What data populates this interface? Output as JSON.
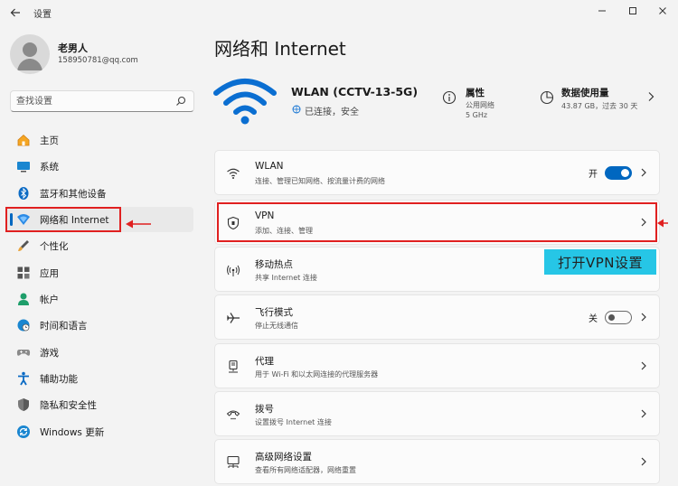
{
  "window": {
    "title": "设置"
  },
  "user": {
    "name": "老男人",
    "email": "158950781@qq.com"
  },
  "search": {
    "placeholder": "查找设置"
  },
  "sidebar": {
    "items": [
      {
        "label": "主页",
        "icon": "home-icon"
      },
      {
        "label": "系统",
        "icon": "monitor-icon"
      },
      {
        "label": "蓝牙和其他设备",
        "icon": "bluetooth-icon"
      },
      {
        "label": "网络和 Internet",
        "icon": "network-icon",
        "selected": true
      },
      {
        "label": "个性化",
        "icon": "brush-icon"
      },
      {
        "label": "应用",
        "icon": "apps-icon"
      },
      {
        "label": "帐户",
        "icon": "account-icon"
      },
      {
        "label": "时间和语言",
        "icon": "globe-clock-icon"
      },
      {
        "label": "游戏",
        "icon": "gamepad-icon"
      },
      {
        "label": "辅助功能",
        "icon": "accessibility-icon"
      },
      {
        "label": "隐私和安全性",
        "icon": "shield-icon"
      },
      {
        "label": "Windows 更新",
        "icon": "update-icon"
      }
    ]
  },
  "main": {
    "title": "网络和 Internet",
    "network": {
      "name": "WLAN (CCTV-13-5G)",
      "status": "已连接，安全"
    },
    "properties": {
      "title": "属性",
      "lines": [
        "公用网络",
        "5 GHz"
      ]
    },
    "usage": {
      "title": "数据使用量",
      "detail": "43.87 GB，过去 30 天"
    },
    "cards": [
      {
        "title": "WLAN",
        "desc": "连接、管理已知网络、按流量计费的网络",
        "icon": "wifi-icon",
        "toggle_label": "开",
        "toggle": "on"
      },
      {
        "title": "VPN",
        "desc": "添加、连接、管理",
        "icon": "vpn-shield-icon"
      },
      {
        "title": "移动热点",
        "desc": "共享 Internet 连接",
        "icon": "hotspot-icon"
      },
      {
        "title": "飞行模式",
        "desc": "停止无线通信",
        "icon": "airplane-icon",
        "toggle_label": "关",
        "toggle": "off"
      },
      {
        "title": "代理",
        "desc": "用于 Wi-Fi 和以太网连接的代理服务器",
        "icon": "proxy-icon"
      },
      {
        "title": "拨号",
        "desc": "设置拨号 Internet 连接",
        "icon": "dialup-icon"
      },
      {
        "title": "高级网络设置",
        "desc": "查看所有网络适配器，网络重置",
        "icon": "advanced-network-icon"
      }
    ]
  },
  "annotation": {
    "text": "打开VPN设置"
  },
  "colors": {
    "accent": "#0067c0",
    "highlight": "#e02020",
    "annotation_bg": "#26c6e6"
  }
}
